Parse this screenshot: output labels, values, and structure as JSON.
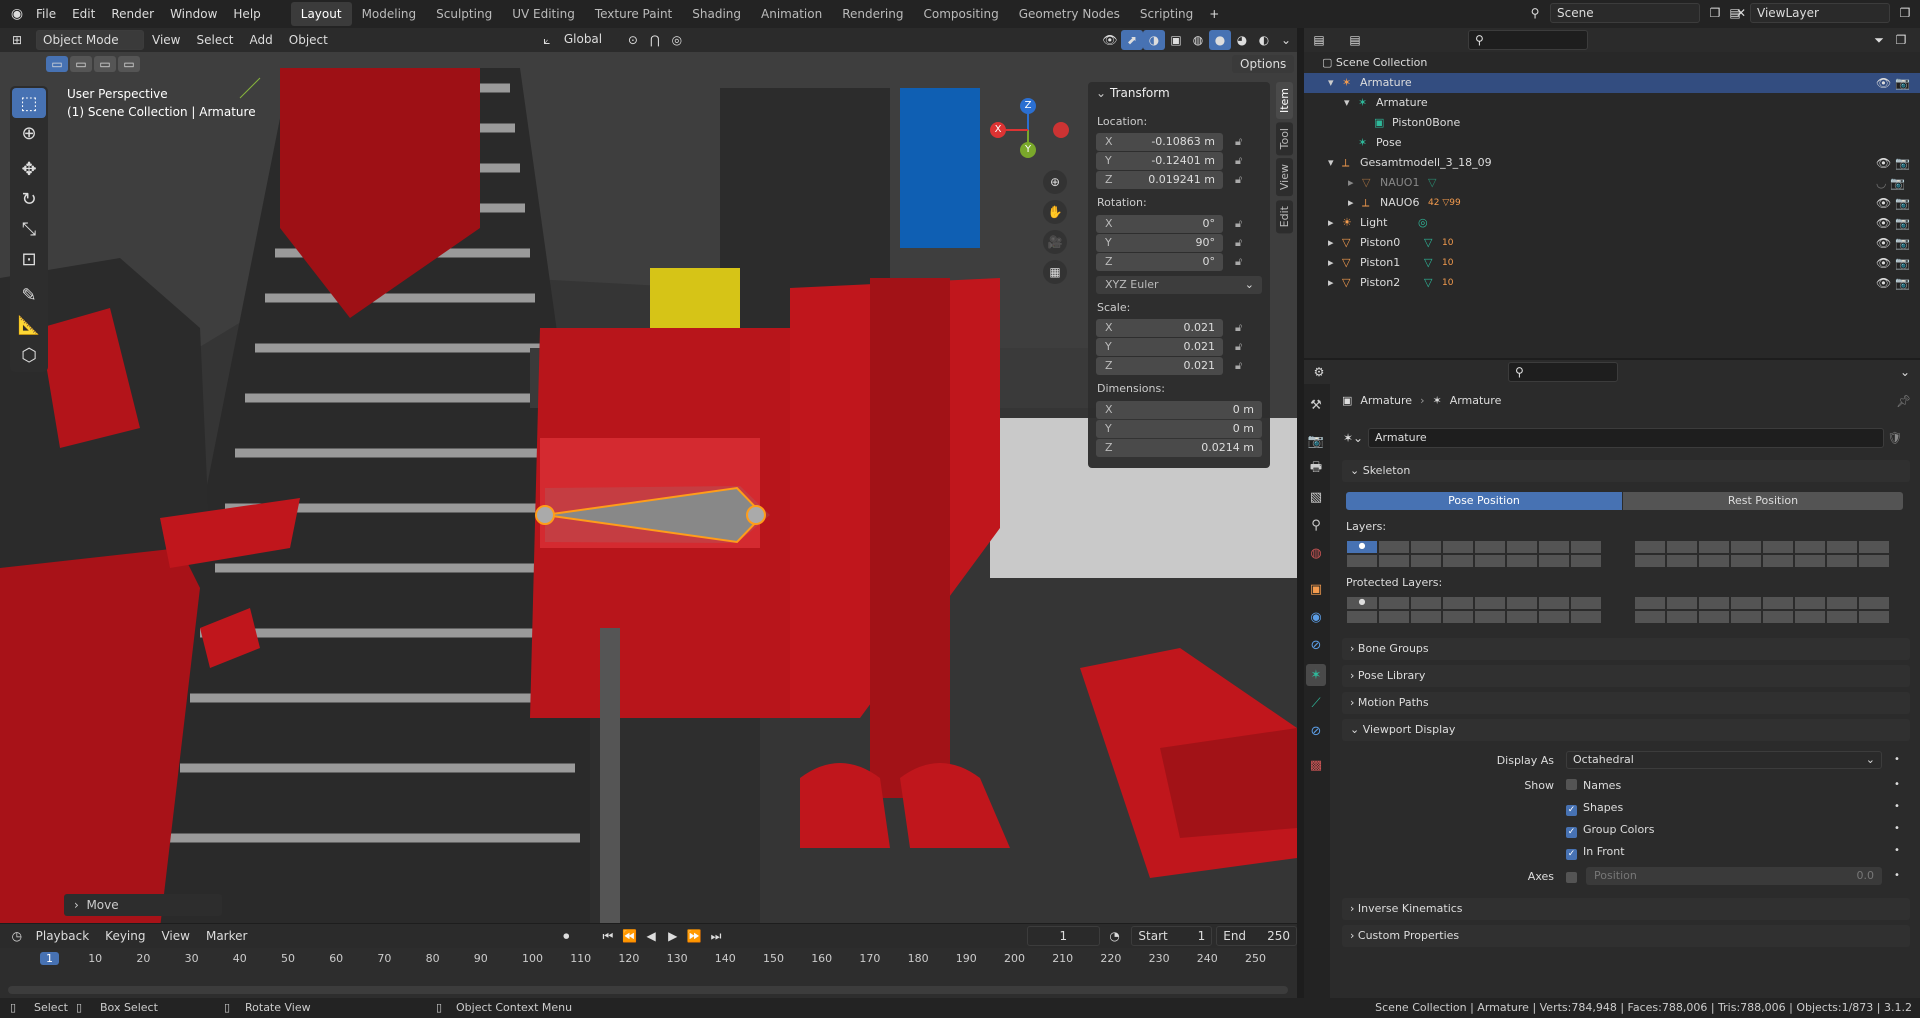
{
  "topbar": {
    "menus": [
      "File",
      "Edit",
      "Render",
      "Window",
      "Help"
    ],
    "workspaces": [
      "Layout",
      "Modeling",
      "Sculpting",
      "UV Editing",
      "Texture Paint",
      "Shading",
      "Animation",
      "Rendering",
      "Compositing",
      "Geometry Nodes",
      "Scripting"
    ],
    "active_workspace": "Layout",
    "scene": "Scene",
    "view_layer": "ViewLayer"
  },
  "viewport_header": {
    "mode": "Object Mode",
    "menus": [
      "View",
      "Select",
      "Add",
      "Object"
    ],
    "orientation": "Global",
    "options_label": "Options"
  },
  "viewport": {
    "perspective": "User Perspective",
    "collection_info": "(1) Scene Collection | Armature",
    "gizmo": {
      "z": "Z",
      "y": "Y",
      "x": "X"
    },
    "last_op": "Move"
  },
  "npanel": {
    "tabs": [
      "Item",
      "Tool",
      "View",
      "Edit"
    ],
    "title": "Transform",
    "location_label": "Location:",
    "location": [
      {
        "axis": "X",
        "value": "-0.10863 m"
      },
      {
        "axis": "Y",
        "value": "-0.12401 m"
      },
      {
        "axis": "Z",
        "value": "0.019241 m"
      }
    ],
    "rotation_label": "Rotation:",
    "rotation": [
      {
        "axis": "X",
        "value": "0°"
      },
      {
        "axis": "Y",
        "value": "90°"
      },
      {
        "axis": "Z",
        "value": "0°"
      }
    ],
    "rotation_mode": "XYZ Euler",
    "scale_label": "Scale:",
    "scale": [
      {
        "axis": "X",
        "value": "0.021"
      },
      {
        "axis": "Y",
        "value": "0.021"
      },
      {
        "axis": "Z",
        "value": "0.021"
      }
    ],
    "dimensions_label": "Dimensions:",
    "dimensions": [
      {
        "axis": "X",
        "value": "0 m"
      },
      {
        "axis": "Y",
        "value": "0 m"
      },
      {
        "axis": "Z",
        "value": "0.0214 m"
      }
    ]
  },
  "outliner": {
    "root": "Scene Collection",
    "rows": [
      {
        "label": "Armature",
        "selected": true,
        "extra": ""
      },
      {
        "label": "Armature",
        "selected": false,
        "extra": ""
      },
      {
        "label": "Piston0Bone",
        "selected": false,
        "extra": ""
      },
      {
        "label": "Pose",
        "selected": false,
        "extra": ""
      },
      {
        "label": "Gesamtmodell_3_18_09",
        "selected": false,
        "extra": ""
      },
      {
        "label": "NAUO1",
        "selected": false,
        "extra": ""
      },
      {
        "label": "NAUO6",
        "selected": false,
        "extra": "42 ▽99"
      },
      {
        "label": "Light",
        "selected": false,
        "extra": ""
      },
      {
        "label": "Piston0",
        "selected": false,
        "extra": "10"
      },
      {
        "label": "Piston1",
        "selected": false,
        "extra": "10"
      },
      {
        "label": "Piston2",
        "selected": false,
        "extra": "10"
      }
    ]
  },
  "properties": {
    "breadcrumb": [
      "Armature",
      "Armature"
    ],
    "datablock": "Armature",
    "skeleton": "Skeleton",
    "pose_position": "Pose Position",
    "rest_position": "Rest Position",
    "layers_label": "Layers:",
    "protected_label": "Protected Layers:",
    "bone_groups": "Bone Groups",
    "pose_library": "Pose Library",
    "motion_paths": "Motion Paths",
    "viewport_display": "Viewport Display",
    "display_as_label": "Display As",
    "display_as": "Octahedral",
    "show_label": "Show",
    "show_names": "Names",
    "show_shapes": "Shapes",
    "show_group_colors": "Group Colors",
    "show_in_front": "In Front",
    "axes_label": "Axes",
    "axes_position": "Position",
    "axes_value": "0.0",
    "inverse_kinematics": "Inverse Kinematics",
    "custom_properties": "Custom Properties"
  },
  "timeline": {
    "menus": [
      "Playback",
      "Keying",
      "View",
      "Marker"
    ],
    "current_frame": "1",
    "start_label": "Start",
    "start": "1",
    "end_label": "End",
    "end": "250",
    "ticks": [
      "1",
      "10",
      "20",
      "30",
      "40",
      "50",
      "60",
      "70",
      "80",
      "90",
      "100",
      "110",
      "120",
      "130",
      "140",
      "150",
      "160",
      "170",
      "180",
      "190",
      "200",
      "210",
      "220",
      "230",
      "240",
      "250"
    ]
  },
  "statusbar": {
    "select": "Select",
    "box_select": "Box Select",
    "rotate_view": "Rotate View",
    "context_menu": "Object Context Menu",
    "info": "Scene Collection | Armature | Verts:784,948 | Faces:788,006 | Tris:788,006 | Objects:1/873 | 3.1.2"
  },
  "colors": {
    "accent": "#4772b3",
    "red": "#c0161c",
    "bone": "#ff9d1a"
  }
}
